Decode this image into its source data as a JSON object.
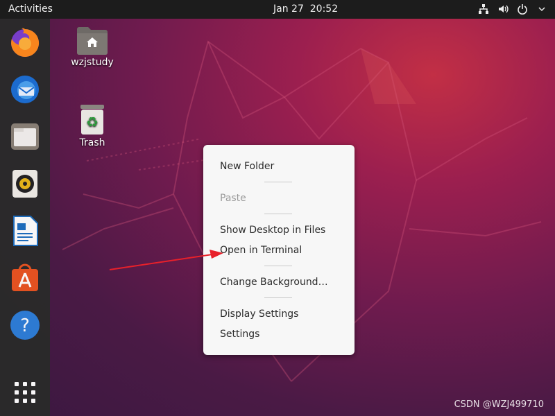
{
  "topbar": {
    "activities_label": "Activities",
    "date": "Jan 27",
    "time": "20:52",
    "tray_icons": [
      "network-icon",
      "volume-icon",
      "power-icon",
      "chevron-down-icon"
    ]
  },
  "dock": {
    "apps": [
      {
        "name": "firefox-icon"
      },
      {
        "name": "thunderbird-icon"
      },
      {
        "name": "files-icon"
      },
      {
        "name": "rhythmbox-icon"
      },
      {
        "name": "libreoffice-writer-icon"
      },
      {
        "name": "ubuntu-software-icon"
      },
      {
        "name": "help-icon"
      },
      {
        "name": "show-applications-icon"
      }
    ]
  },
  "desktop": {
    "home_folder_label": "wzjstudy",
    "trash_label": "Trash"
  },
  "context_menu": {
    "new_folder": "New Folder",
    "paste": "Paste",
    "show_desktop_in_files": "Show Desktop in Files",
    "open_in_terminal": "Open in Terminal",
    "change_background": "Change Background…",
    "display_settings": "Display Settings",
    "settings": "Settings"
  },
  "colors": {
    "topbar": "#1c1c1c",
    "dock": "#2a2a2a",
    "menu_bg": "#f7f7f7",
    "arrow": "#e8202a"
  },
  "watermark": "CSDN @WZJ499710"
}
